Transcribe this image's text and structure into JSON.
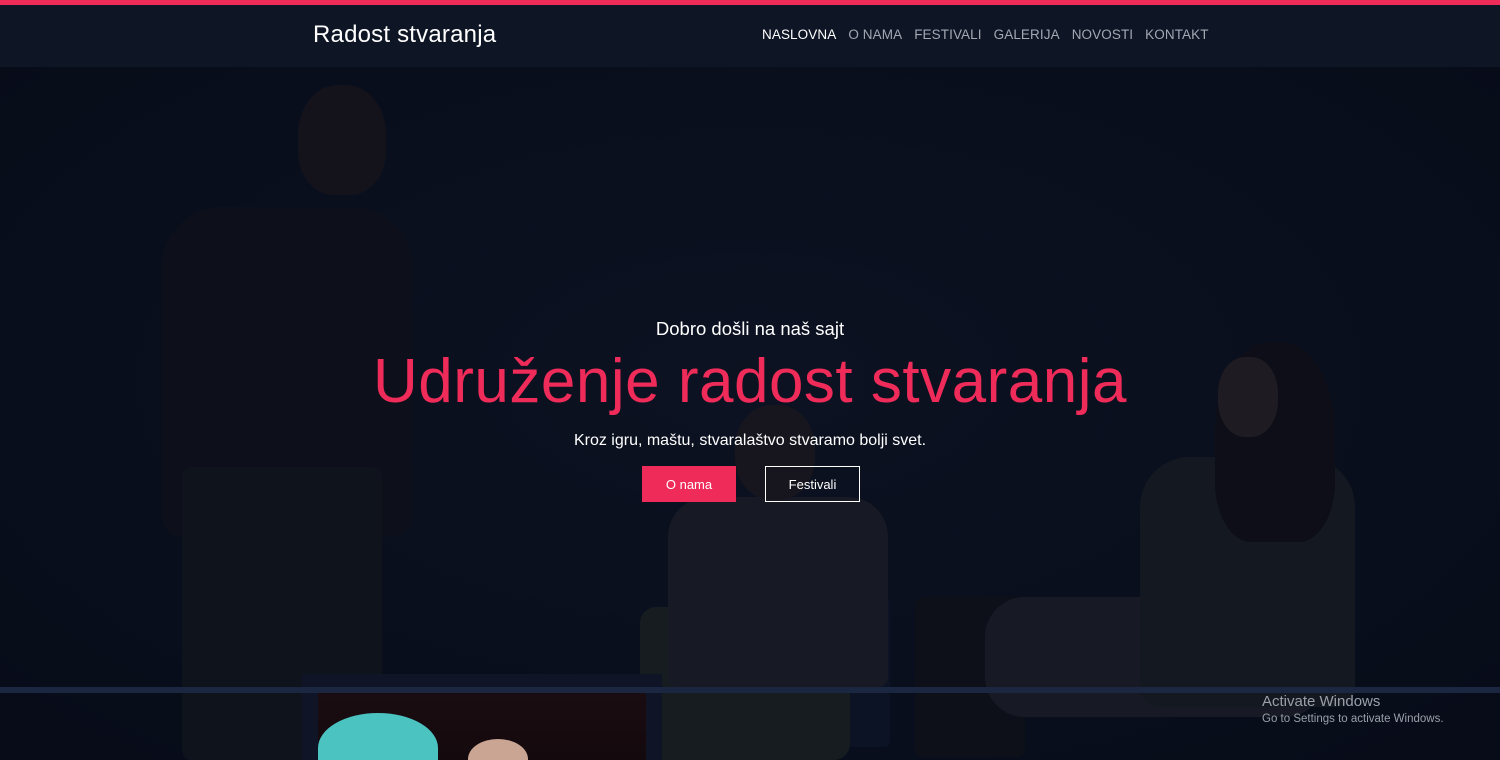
{
  "colors": {
    "accent": "#ef2b59",
    "nav_bg": "#0e1524",
    "page_bg": "#0c1120"
  },
  "header": {
    "brand": "Radost stvaranja",
    "nav": [
      {
        "label": "NASLOVNA",
        "active": true
      },
      {
        "label": "O NAMA",
        "active": false
      },
      {
        "label": "FESTIVALI",
        "active": false
      },
      {
        "label": "GALERIJA",
        "active": false
      },
      {
        "label": "NOVOSTI",
        "active": false
      },
      {
        "label": "KONTAKT",
        "active": false
      }
    ]
  },
  "hero": {
    "welcome": "Dobro došli na naš sajt",
    "title": "Udruženje radost stvaranja",
    "subtitle": "Kroz igru, maštu, stvaralaštvo stvaramo bolji svet.",
    "primary_button": "O nama",
    "secondary_button": "Festivali"
  },
  "watermark": {
    "title": "Activate Windows",
    "subtitle": "Go to Settings to activate Windows."
  }
}
